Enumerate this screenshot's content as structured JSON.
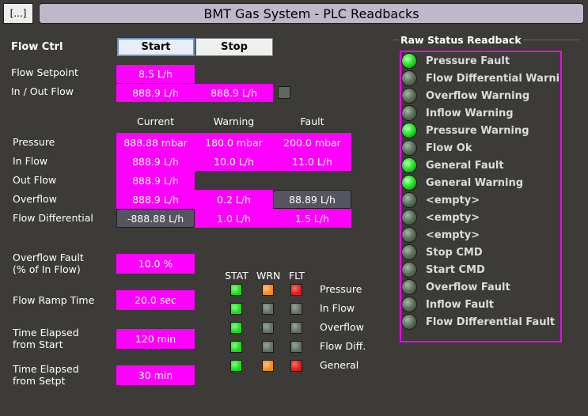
{
  "header": {
    "menu_label": "[...]",
    "title": "BMT Gas System - PLC Readbacks"
  },
  "flow_ctrl": {
    "label": "Flow Ctrl",
    "start_label": "Start",
    "stop_label": "Stop"
  },
  "flow_setpoint": {
    "label": "Flow Setpoint",
    "value": "8.5 L/h"
  },
  "in_out_flow": {
    "label": "In / Out Flow",
    "in_value": "888.9 L/h",
    "out_value": "888.9 L/h"
  },
  "table": {
    "headers": [
      "Current",
      "Warning",
      "Fault"
    ],
    "rows": [
      {
        "label": "Pressure",
        "current": "888.88 mbar",
        "warning": "180.0 mbar",
        "fault": "200.0 mbar"
      },
      {
        "label": "In Flow",
        "current": "888.9 L/h",
        "warning": "10.0 L/h",
        "fault": "11.0 L/h"
      },
      {
        "label": "Out Flow",
        "current": "888.9 L/h",
        "warning": "",
        "fault": ""
      },
      {
        "label": "Overflow",
        "current": "888.9 L/h",
        "warning": "0.2 L/h",
        "fault": "88.89 L/h"
      },
      {
        "label": "Flow Differential",
        "current": "-888.88 L/h",
        "warning": "1.0 L/h",
        "fault": "1.5 L/h"
      }
    ]
  },
  "settings": [
    {
      "label1": "Overflow Fault",
      "label2": "(% of In Flow)",
      "value": "10.0 %"
    },
    {
      "label1": "Flow Ramp Time",
      "label2": "",
      "value": "20.0 sec"
    },
    {
      "label1": "Time Elapsed",
      "label2": "from Start",
      "value": "120 min"
    },
    {
      "label1": "Time Elapsed",
      "label2": "from Setpt",
      "value": "30 min"
    }
  ],
  "indicator_grid": {
    "columns": [
      "STAT",
      "WRN",
      "FLT"
    ],
    "rows": [
      {
        "label": "Pressure",
        "stat": "green",
        "wrn": "orange",
        "flt": "red"
      },
      {
        "label": "In Flow",
        "stat": "green",
        "wrn": "off",
        "flt": "off"
      },
      {
        "label": "Overflow",
        "stat": "green",
        "wrn": "off",
        "flt": "off"
      },
      {
        "label": "Flow Diff.",
        "stat": "green",
        "wrn": "off",
        "flt": "off"
      },
      {
        "label": "General",
        "stat": "green",
        "wrn": "orange",
        "flt": "red"
      }
    ]
  },
  "raw_status": {
    "title": "Raw Status Readback",
    "items": [
      {
        "label": "Pressure Fault",
        "on": true
      },
      {
        "label": "Flow Differential Warning",
        "on": false
      },
      {
        "label": "Overflow Warning",
        "on": false
      },
      {
        "label": "Inflow Warning",
        "on": false
      },
      {
        "label": "Pressure Warning",
        "on": true
      },
      {
        "label": "Flow Ok",
        "on": false
      },
      {
        "label": "General Fault",
        "on": true
      },
      {
        "label": "General Warning",
        "on": true
      },
      {
        "label": "<empty>",
        "on": false
      },
      {
        "label": "<empty>",
        "on": false
      },
      {
        "label": "<empty>",
        "on": false
      },
      {
        "label": "Stop CMD",
        "on": false
      },
      {
        "label": "Start CMD",
        "on": false
      },
      {
        "label": "Overflow Fault",
        "on": false
      },
      {
        "label": "Inflow Fault",
        "on": false
      },
      {
        "label": "Flow Differential Fault",
        "on": false
      }
    ]
  },
  "colors": {
    "background": "#3c3b37",
    "highlight": "#ff00ff",
    "title_bar": "#c0b7c9"
  }
}
